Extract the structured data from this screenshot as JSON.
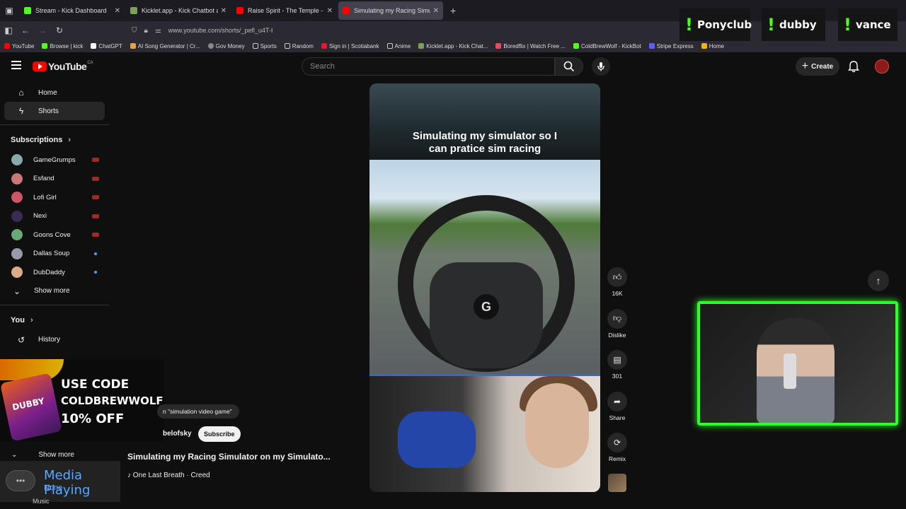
{
  "browser": {
    "tabs": [
      {
        "title": "Stream - Kick Dashboard",
        "color": "#53fc18",
        "active": false
      },
      {
        "title": "Kicklet.app - Kick Chatbot and C",
        "color": "#7aa05a",
        "active": false
      },
      {
        "title": "Raise Spirit - The Temple - YouT",
        "color": "#ff0000",
        "active": false
      },
      {
        "title": "Simulating my Racing Simu",
        "color": "#ff0000",
        "active": true
      }
    ],
    "url": "www.youtube.com/shorts/_pefl_u4T-I",
    "bookmarks": [
      {
        "label": "YouTube",
        "color": "#ff0000"
      },
      {
        "label": "Browse | kick",
        "color": "#53fc18"
      },
      {
        "label": "ChatGPT",
        "color": "#ffffff"
      },
      {
        "label": "AI Song Generator | Cr...",
        "color": "#e8a040"
      },
      {
        "label": "Gov Money",
        "color": "#cccccc"
      },
      {
        "label": "Sports",
        "color": "#cccccc"
      },
      {
        "label": "Random",
        "color": "#cccccc"
      },
      {
        "label": "Sign in | Scotiabank",
        "color": "#e31837"
      },
      {
        "label": "Anime",
        "color": "#cccccc"
      },
      {
        "label": "Kicklet.app - Kick Chat...",
        "color": "#7aa05a"
      },
      {
        "label": "Boredflix | Watch Free ...",
        "color": "#e84a5f"
      },
      {
        "label": "ColdBrewWolf - KickBot",
        "color": "#53fc18"
      },
      {
        "label": "Stripe Express",
        "color": "#635bff"
      },
      {
        "label": "Home",
        "color": "#f4b400"
      }
    ]
  },
  "overlay_tags": [
    "Ponyclub",
    "dubby",
    "vance"
  ],
  "header": {
    "logo_text": "YouTube",
    "region": "CA",
    "search_placeholder": "Search",
    "create_label": "Create"
  },
  "sidebar": {
    "items": [
      {
        "label": "Home",
        "icon": "home-icon"
      },
      {
        "label": "Shorts",
        "icon": "shorts-icon"
      }
    ],
    "subscriptions_label": "Subscriptions",
    "subscriptions": [
      {
        "name": "GameGrumps",
        "color": "#8aa",
        "status": "live"
      },
      {
        "name": "Esfand",
        "color": "#c77",
        "status": "live"
      },
      {
        "name": "Lofi Girl",
        "color": "#c56",
        "status": "live"
      },
      {
        "name": "Nexi",
        "color": "#3a2a55",
        "status": "live"
      },
      {
        "name": "Goons Cove",
        "color": "#6a7",
        "status": "live"
      },
      {
        "name": "Dallas Soup",
        "color": "#99a",
        "status": "new"
      },
      {
        "name": "DubDaddy",
        "color": "#da8",
        "status": "new"
      }
    ],
    "show_more": "Show more",
    "you_label": "You",
    "history_label": "History"
  },
  "promo": {
    "line1": "USE CODE",
    "line2": "COLDBREWWOLF",
    "line3": "10% OFF",
    "can_label": "DUBBY"
  },
  "video": {
    "caption": "Simulating my simulator so I can pratice sim racing",
    "search_pill": "n \"simulation video game\"",
    "channel": "belofsky",
    "subscribe_label": "Subscribe",
    "title": "Simulating my Racing Simulator on my Simulato...",
    "song": "One Last Breath · Creed",
    "likes": "16K",
    "dislike_label": "Dislike",
    "comments": "301",
    "share_label": "Share",
    "remix_label": "Remix"
  },
  "media_widget": {
    "title": "Media Playing",
    "subtitle": "None"
  },
  "sidebar_bottom": {
    "show_more": "Show more",
    "music": "Music"
  }
}
